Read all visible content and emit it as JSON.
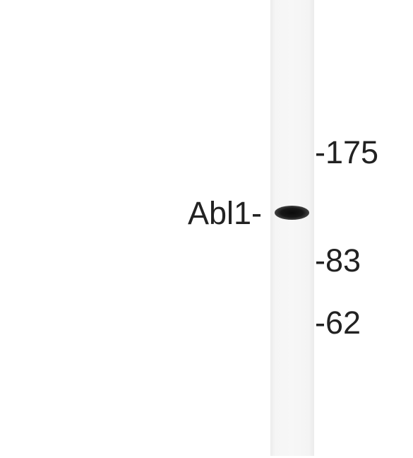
{
  "blot": {
    "protein_label": "Abl1-",
    "markers": [
      "-175",
      "-83",
      "-62"
    ]
  }
}
